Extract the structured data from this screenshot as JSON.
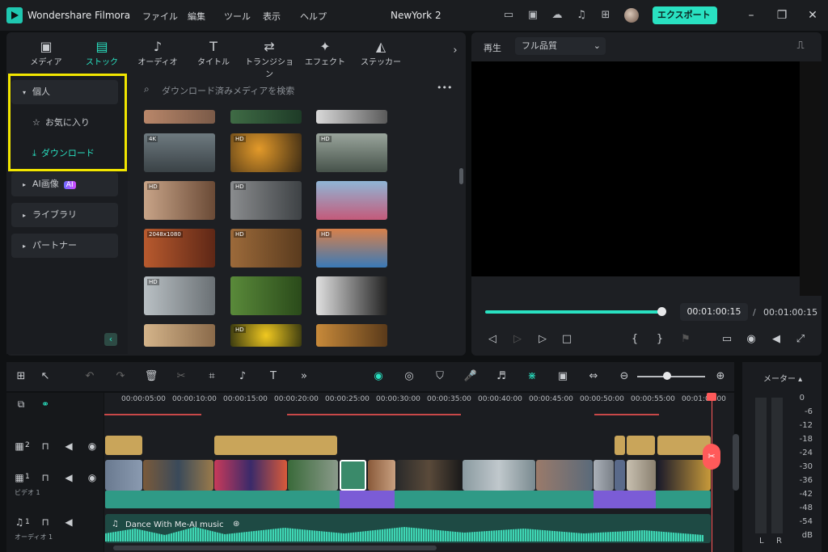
{
  "titlebar": {
    "app_name": "Wondershare Filmora",
    "menus": [
      "ファイル",
      "編集",
      "ツール",
      "表示",
      "ヘルプ"
    ],
    "project": "NewYork 2",
    "export_label": "エクスポート ⌄"
  },
  "media_tabs": [
    {
      "label": "メディア",
      "icon": "media-icon"
    },
    {
      "label": "ストック",
      "icon": "cloud-folder-icon"
    },
    {
      "label": "オーディオ",
      "icon": "music-note-icon"
    },
    {
      "label": "タイトル",
      "icon": "title-t-icon"
    },
    {
      "label": "トランジション",
      "icon": "transition-icon"
    },
    {
      "label": "エフェクト",
      "icon": "effect-star-icon"
    },
    {
      "label": "ステッカー",
      "icon": "sticker-icon"
    }
  ],
  "sidebar": {
    "personal": "個人",
    "favorites": "お気に入り",
    "downloads": "ダウンロード",
    "ai_image": "AI画像",
    "ai_badge": "AI",
    "library": "ライブラリ",
    "partner": "パートナー"
  },
  "search": {
    "placeholder": "ダウンロード済みメディアを検索",
    "more": "•••"
  },
  "thumb_tags": [
    "",
    "",
    "",
    "4K",
    "HD",
    "HD",
    "HD",
    "HD",
    "",
    "2048x1080",
    "HD",
    "HD",
    "HD",
    "",
    "",
    "",
    "HD",
    ""
  ],
  "preview": {
    "play_label": "再生",
    "quality": "フル品質",
    "progress": 1.0,
    "current_time": "00:01:00:15",
    "separator": "/",
    "total_time": "00:01:00:15",
    "brace_open": "{",
    "brace_close": "}"
  },
  "timeline": {
    "ruler": [
      "00:00:05:00",
      "00:00:10:00",
      "00:00:15:00",
      "00:00:20:00",
      "00:00:25:00",
      "00:00:30:00",
      "00:00:35:00",
      "00:00:40:00",
      "00:00:45:00",
      "00:00:50:00",
      "00:00:55:00",
      "00:01:00:00"
    ],
    "track2_num": "2",
    "track1_num": "1",
    "video_label": "ビデオ 1",
    "audio_num": "1",
    "audio_label": "オーディオ 1",
    "audio_clip": "Dance With Me-AI music"
  },
  "meter": {
    "label": "メーター ▴",
    "scale": [
      "0",
      "-6",
      "-12",
      "-18",
      "-24",
      "-30",
      "-36",
      "-42",
      "-48",
      "-54",
      "dB"
    ],
    "left": "L",
    "right": "R"
  },
  "colors": {
    "accent": "#29e1c1",
    "title_clip": "#c9a55a",
    "video_clip": "#2f9a86",
    "image_clip": "#7b5cd6",
    "playhead": "#ff5a5a",
    "highlight": "#f2e600"
  }
}
